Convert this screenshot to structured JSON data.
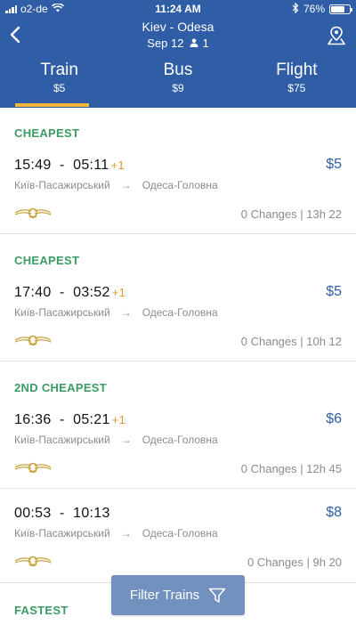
{
  "status_bar": {
    "carrier": "o2-de",
    "time": "11:24 AM",
    "battery": "76%",
    "battery_level": 0.76
  },
  "header": {
    "route": "Kiev - Odesa",
    "date": "Sep 12",
    "passengers": "1",
    "icons": {
      "back": "back-arrow-icon",
      "map": "map-pin-icon",
      "passenger": "person-icon"
    }
  },
  "tabs": [
    {
      "label": "Train",
      "price": "$5",
      "active": true
    },
    {
      "label": "Bus",
      "price": "$9",
      "active": false
    },
    {
      "label": "Flight",
      "price": "$75",
      "active": false
    }
  ],
  "results": [
    {
      "badge": "CHEAPEST",
      "depart": "15:49",
      "arrive": "05:11",
      "day_offset": "+1",
      "price": "$5",
      "from": "Київ-Пасажирський",
      "to": "Одеса-Головна",
      "summary": "0 Changes | 13h 22"
    },
    {
      "badge": "CHEAPEST",
      "depart": "17:40",
      "arrive": "03:52",
      "day_offset": "+1",
      "price": "$5",
      "from": "Київ-Пасажирський",
      "to": "Одеса-Головна",
      "summary": "0 Changes | 10h 12"
    },
    {
      "badge": "2ND CHEAPEST",
      "depart": "16:36",
      "arrive": "05:21",
      "day_offset": "+1",
      "price": "$6",
      "from": "Київ-Пасажирський",
      "to": "Одеса-Головна",
      "summary": "0 Changes | 12h 45"
    },
    {
      "badge": "",
      "depart": "00:53",
      "arrive": "10:13",
      "day_offset": "",
      "price": "$8",
      "from": "Київ-Пасажирський",
      "to": "Одеса-Головна",
      "summary": "0 Changes | 9h 20"
    },
    {
      "badge": "FASTEST"
    }
  ],
  "filter_button": {
    "label": "Filter Trains",
    "icon": "filter-funnel-icon"
  },
  "colors": {
    "header": "#2f5ea6",
    "tab_indicator": "#f2b63d",
    "badge": "#3b9b64",
    "price": "#2f5ea6",
    "day_offset": "#e8962f",
    "filter_button": "#7291bf"
  }
}
